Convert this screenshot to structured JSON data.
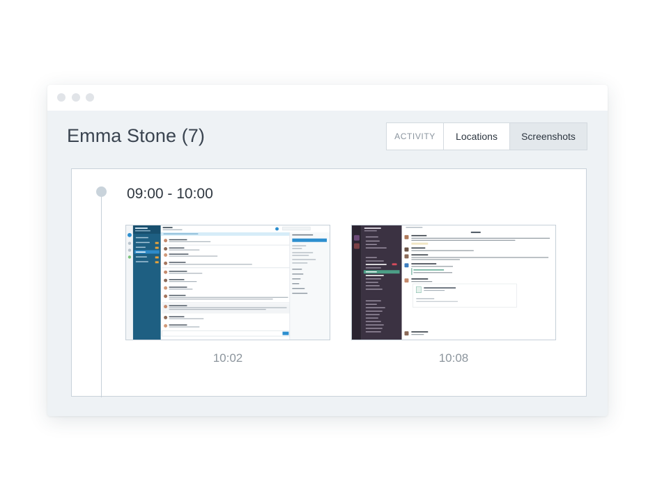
{
  "profile": {
    "title": "Emma Stone (7)"
  },
  "tabs": [
    {
      "label": "ACTIVITY"
    },
    {
      "label": "Locations"
    },
    {
      "label": "Screenshots"
    }
  ],
  "timeline": {
    "range": "09:00 - 10:00",
    "screenshots": [
      {
        "time": "10:02"
      },
      {
        "time": "10:08"
      }
    ]
  }
}
